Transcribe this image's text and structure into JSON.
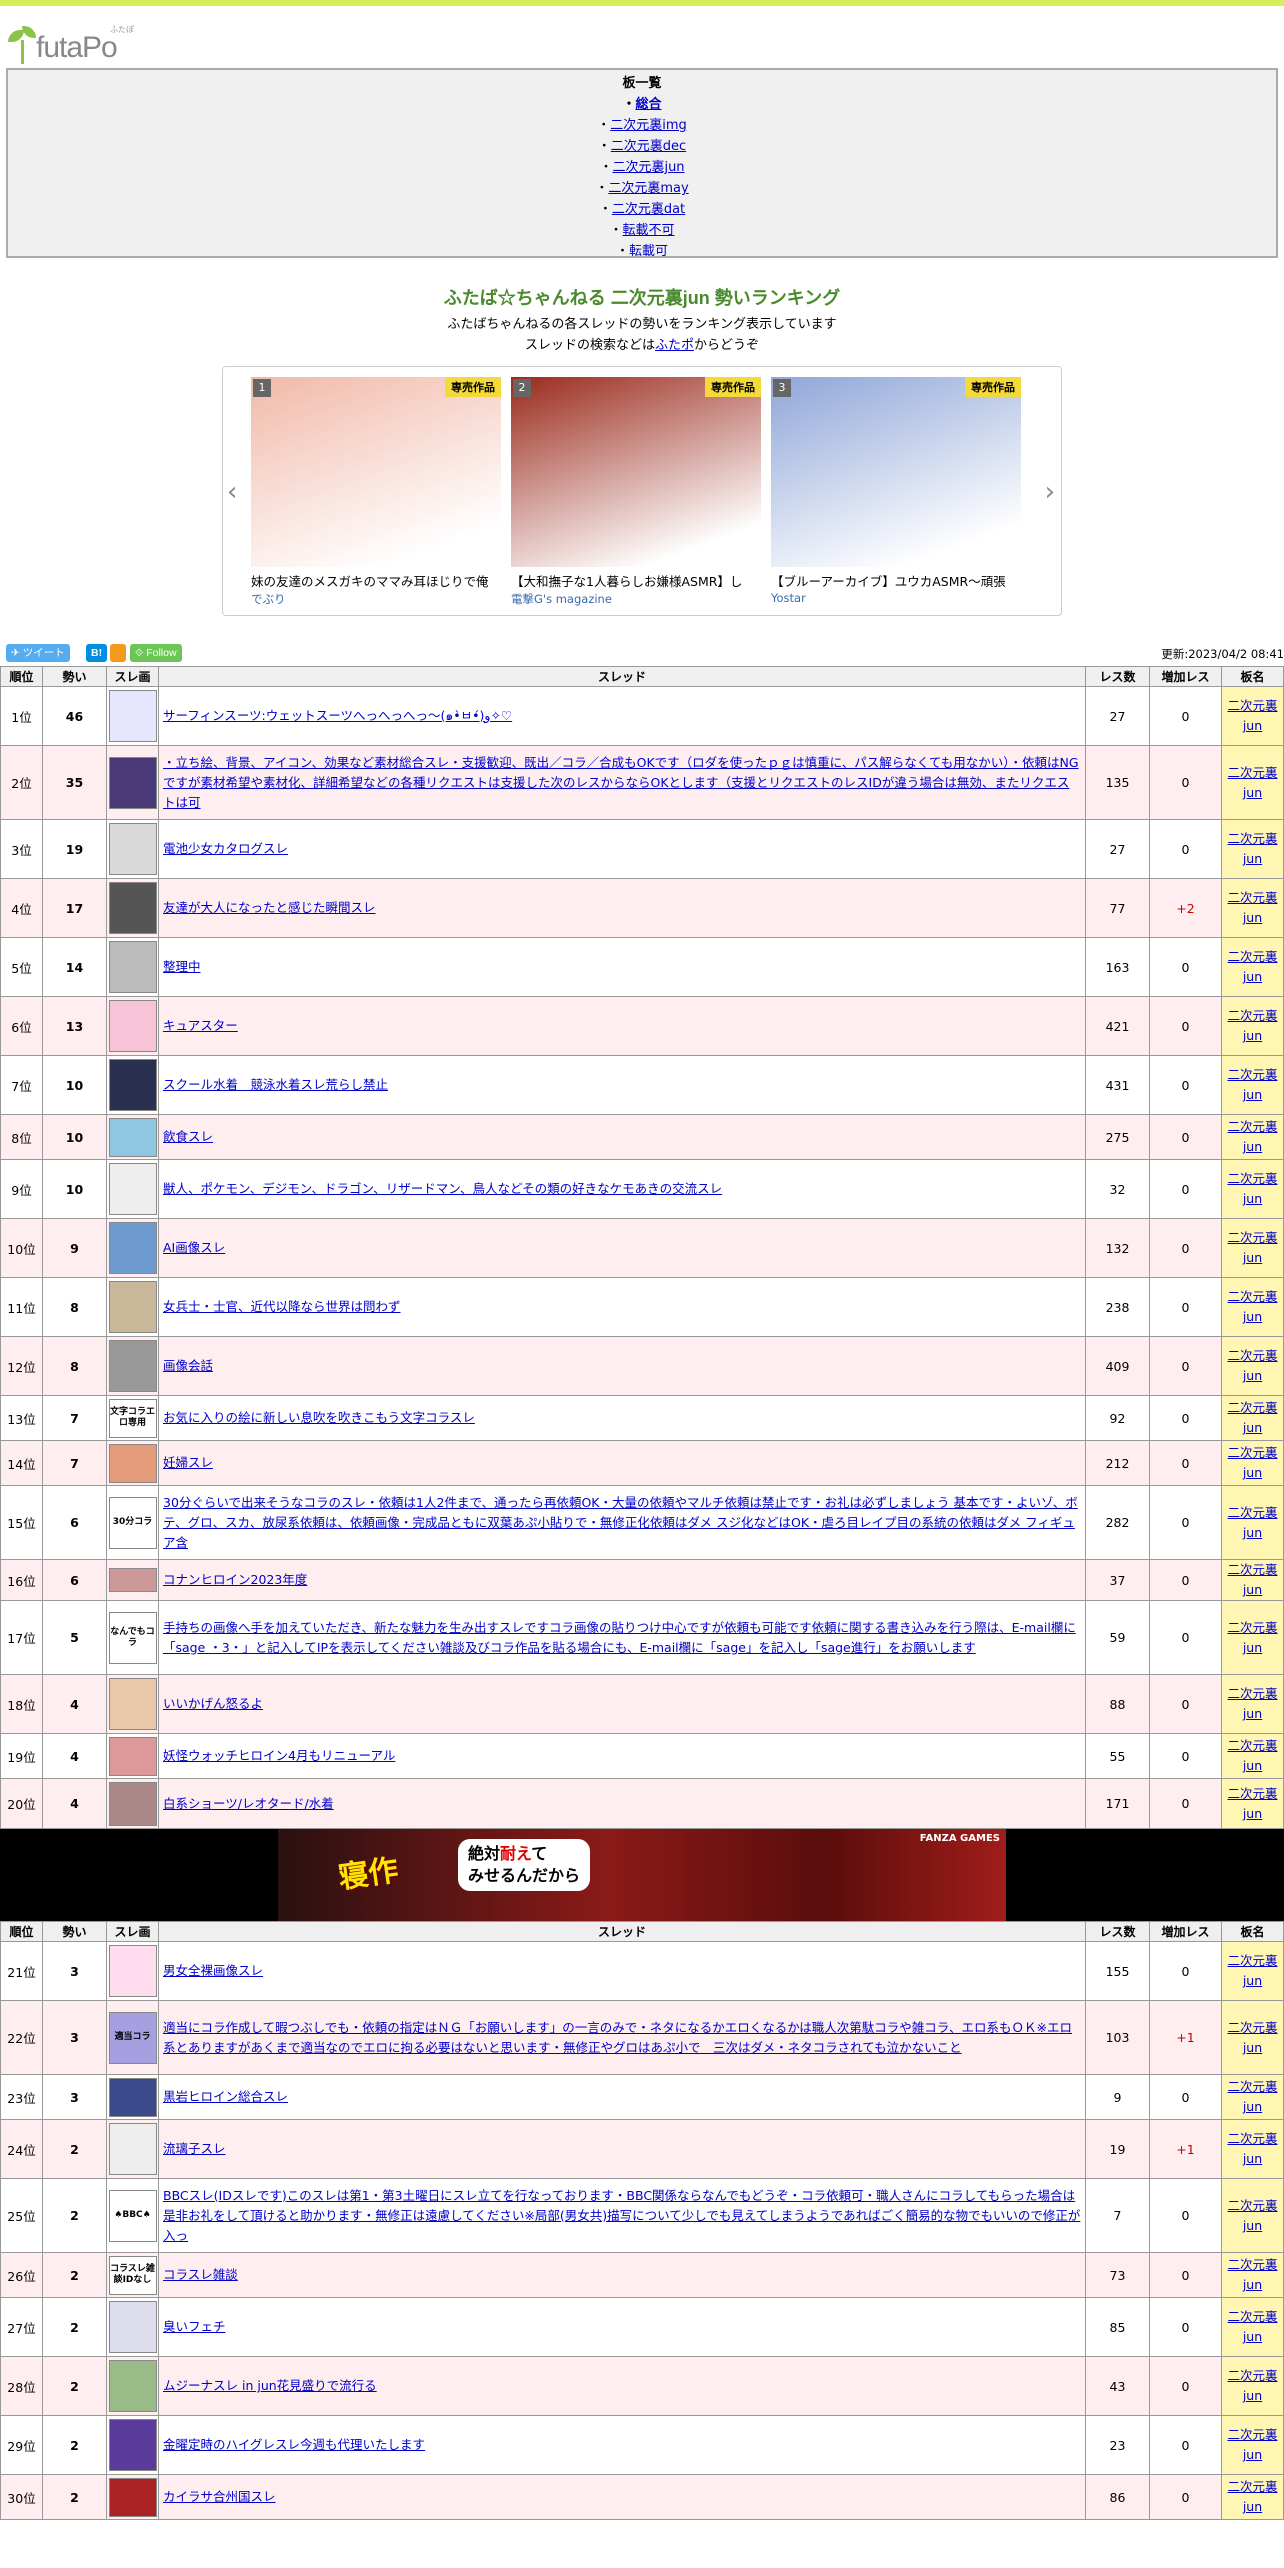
{
  "site": {
    "logo": "futaPo",
    "logo_ruby": "ふたぽ"
  },
  "board_list": {
    "title": "板一覧",
    "items": [
      {
        "label": "総合",
        "selected": true
      },
      {
        "label": "二次元裏img"
      },
      {
        "label": "二次元裏dec"
      },
      {
        "label": "二次元裏jun"
      },
      {
        "label": "二次元裏may"
      },
      {
        "label": "二次元裏dat"
      },
      {
        "label": "転載不可"
      },
      {
        "label": "転載可"
      }
    ]
  },
  "page": {
    "title": "ふたば☆ちゃんねる 二次元裏jun 勢いランキング",
    "desc1": "ふたばちゃんねるの各スレッドの勢いをランキング表示しています",
    "desc2_pre": "スレッドの検索などは",
    "desc2_link": "ふたポ",
    "desc2_post": "からどうぞ"
  },
  "carousel": [
    {
      "rank": "1",
      "tag": "専売作品",
      "title": "妹の友達のメスガキのママみ耳ほじりで俺",
      "circle": "でぶり",
      "color": "#f1b9a8"
    },
    {
      "rank": "2",
      "tag": "専売作品",
      "title": "【大和撫子な1人暮らしお嫌様ASMR】し",
      "circle": "電撃G's magazine",
      "color": "#9a2a1c"
    },
    {
      "rank": "3",
      "tag": "専売作品",
      "title": "【ブルーアーカイブ】ユウカASMR～頑張",
      "circle": "Yostar",
      "color": "#8fa6d8"
    }
  ],
  "social": {
    "tweet": "ツイート",
    "hb": "B!",
    "follow": "Follow",
    "updated": "更新:2023/04/2 08:41"
  },
  "table": {
    "headers": [
      "順位",
      "勢い",
      "スレ画",
      "スレッド",
      "レス数",
      "増加レス",
      "板名"
    ],
    "rows1": [
      {
        "rank": "1位",
        "mom": "46",
        "title": "サーフィンスーツ:ウェットスーツへっへっへっ～(๑•̀ㅂ•́)و✧♡",
        "res": "27",
        "inc": "0",
        "board": "二次元裏jun",
        "thumb": "#e6e6ff"
      },
      {
        "rank": "2位",
        "mom": "35",
        "title": "・立ち絵、背景、アイコン、効果など素材総合スレ・支援歓迎、既出／コラ／合成もOKです（ロダを使ったｐｇは慎重に、パス解らなくても用なかい）・依頼はNGですが素材希望や素材化、詳細希望などの各種リクエストは支援した次のレスからならOKとします（支援とリクエストのレスIDが違う場合は無効、またリクエストは可",
        "res": "135",
        "inc": "0",
        "board": "二次元裏jun",
        "thumb": "#4a3a7a"
      },
      {
        "rank": "3位",
        "mom": "19",
        "title": "電池少女カタログスレ",
        "res": "27",
        "inc": "0",
        "board": "二次元裏jun",
        "thumb": "#d9d9d9"
      },
      {
        "rank": "4位",
        "mom": "17",
        "title": "友達が大人になったと感じた瞬間スレ",
        "res": "77",
        "inc": "+2",
        "board": "二次元裏jun",
        "thumb": "#555"
      },
      {
        "rank": "5位",
        "mom": "14",
        "title": "整理中",
        "res": "163",
        "inc": "0",
        "board": "二次元裏jun",
        "thumb": "#bbb"
      },
      {
        "rank": "6位",
        "mom": "13",
        "title": "キュアスター",
        "res": "421",
        "inc": "0",
        "board": "二次元裏jun",
        "thumb": "#f7c3d6"
      },
      {
        "rank": "7位",
        "mom": "10",
        "title": "スクール水着　競泳水着スレ荒らし禁止",
        "res": "431",
        "inc": "0",
        "board": "二次元裏jun",
        "thumb": "#2a3050"
      },
      {
        "rank": "8位",
        "mom": "10",
        "title": "飲食スレ",
        "res": "275",
        "inc": "0",
        "board": "二次元裏jun",
        "thumb": "#8fc7e0"
      },
      {
        "rank": "9位",
        "mom": "10",
        "title": "獣人、ポケモン、デジモン、ドラゴン、リザードマン、鳥人などその類の好きなケモあきの交流スレ",
        "res": "32",
        "inc": "0",
        "board": "二次元裏jun",
        "thumb": "#eee"
      },
      {
        "rank": "10位",
        "mom": "9",
        "title": "AI画像スレ",
        "res": "132",
        "inc": "0",
        "board": "二次元裏jun",
        "thumb": "#6d9bd0"
      },
      {
        "rank": "11位",
        "mom": "8",
        "title": "女兵士・士官、近代以降なら世界は問わず",
        "res": "238",
        "inc": "0",
        "board": "二次元裏jun",
        "thumb": "#c9b79a"
      },
      {
        "rank": "12位",
        "mom": "8",
        "title": "画像会話",
        "res": "409",
        "inc": "0",
        "board": "二次元裏jun",
        "thumb": "#999"
      },
      {
        "rank": "13位",
        "mom": "7",
        "title": "お気に入りの絵に新しい息吹を吹きこもう文字コラスレ",
        "res": "92",
        "inc": "0",
        "board": "二次元裏jun",
        "thumb": "#fff",
        "text": "文字コラエロ専用"
      },
      {
        "rank": "14位",
        "mom": "7",
        "title": "妊婦スレ",
        "res": "212",
        "inc": "0",
        "board": "二次元裏jun",
        "thumb": "#e59a7a"
      },
      {
        "rank": "15位",
        "mom": "6",
        "title": "30分ぐらいで出来そうなコラのスレ・依頼は1人2件まで、通ったら再依頼OK・大量の依頼やマルチ依頼は禁止です・お礼は必ずしましょう 基本です・よいゾ、ボテ、グロ、スカ、放尿系依頼は、依頼画像・完成品ともに双葉あぷ小貼りで・無修正化依頼はダメ スジ化などはOK・虐ろ目レイプ目の系統の依頼はダメ フィギュア含",
        "res": "282",
        "inc": "0",
        "board": "二次元裏jun",
        "thumb": "#fff",
        "text": "30分コラ"
      },
      {
        "rank": "16位",
        "mom": "6",
        "title": "コナンヒロイン2023年度",
        "res": "37",
        "inc": "0",
        "board": "二次元裏jun",
        "thumb": "#c99"
      },
      {
        "rank": "17位",
        "mom": "5",
        "title": "手持ちの画像へ手を加えていただき、新たな魅力を生み出すスレですコラ画像の貼りつけ中心ですが依頼も可能です依頼に関する書き込みを行う際は、E-mail欄に「sage ・3・」と記入してIPを表示してください雑談及びコラ作品を貼る場合にも、E-mail欄に「sage」を記入し「sage進行」をお願いします",
        "res": "59",
        "inc": "0",
        "board": "二次元裏jun",
        "thumb": "#fff",
        "text": "なんでもコラ"
      },
      {
        "rank": "18位",
        "mom": "4",
        "title": "いいかげん怒るよ",
        "res": "88",
        "inc": "0",
        "board": "二次元裏jun",
        "thumb": "#e8c8a8"
      },
      {
        "rank": "19位",
        "mom": "4",
        "title": "妖怪ウォッチヒロイン4月もリニューアル",
        "res": "55",
        "inc": "0",
        "board": "二次元裏jun",
        "thumb": "#d99"
      },
      {
        "rank": "20位",
        "mom": "4",
        "title": "白系ショーツ/レオタード/水着",
        "res": "171",
        "inc": "0",
        "board": "二次元裏jun",
        "thumb": "#a88"
      }
    ],
    "rows2": [
      {
        "rank": "21位",
        "mom": "3",
        "title": "男女全裸画像スレ",
        "res": "155",
        "inc": "0",
        "board": "二次元裏jun",
        "thumb": "#fde"
      },
      {
        "rank": "22位",
        "mom": "3",
        "title": "適当にコラ作成して暇つぶしでも・依頼の指定はＮＧ「お願いします」の一言のみで・ネタになるかエロくなるかは職人次第駄コラや雑コラ、エロ系もＯＫ※エロ系とありますがあくまで適当なのでエロに拘る必要はないと思います・無修正やグロはあぷ小で　三次はダメ・ネタコラされても泣かないこと",
        "res": "103",
        "inc": "+1",
        "board": "二次元裏jun",
        "thumb": "#a6a0e0",
        "text": "適当コラ"
      },
      {
        "rank": "23位",
        "mom": "3",
        "title": "黒岩ヒロイン総合スレ",
        "res": "9",
        "inc": "0",
        "board": "二次元裏jun",
        "thumb": "#3a4a8a"
      },
      {
        "rank": "24位",
        "mom": "2",
        "title": "流璃子スレ",
        "res": "19",
        "inc": "+1",
        "board": "二次元裏jun",
        "thumb": "#eee"
      },
      {
        "rank": "25位",
        "mom": "2",
        "title": "BBCスレ(IDスレです)このスレは第1・第3土曜日にスレ立てを行なっております・BBC関係ならなんでもどうぞ・コラ依頼可・職人さんにコラしてもらった場合は是非お礼をして頂けると助かります・無修正は遠慮してください※局部(男女共)描写について少しでも見えてしまうようであればごく簡易的な物でもいいので修正が入っ",
        "res": "7",
        "inc": "0",
        "board": "二次元裏jun",
        "thumb": "#fff",
        "text": "♠BBC♠"
      },
      {
        "rank": "26位",
        "mom": "2",
        "title": "コラスレ雑談",
        "res": "73",
        "inc": "0",
        "board": "二次元裏jun",
        "thumb": "#fff",
        "text": "コラスレ雑談IDなし"
      },
      {
        "rank": "27位",
        "mom": "2",
        "title": "臭いフェチ",
        "res": "85",
        "inc": "0",
        "board": "二次元裏jun",
        "thumb": "#dde"
      },
      {
        "rank": "28位",
        "mom": "2",
        "title": "ムジーナスレ in jun花見盛りで流行る",
        "res": "43",
        "inc": "0",
        "board": "二次元裏jun",
        "thumb": "#9b8"
      },
      {
        "rank": "29位",
        "mom": "2",
        "title": "金曜定時のハイグレスレ今週も代理いたします",
        "res": "23",
        "inc": "0",
        "board": "二次元裏jun",
        "thumb": "#5a3a9a"
      },
      {
        "rank": "30位",
        "mom": "2",
        "title": "カイラサ合州国スレ",
        "res": "86",
        "inc": "0",
        "board": "二次元裏jun",
        "thumb": "#a22"
      }
    ]
  },
  "ad": {
    "main": "寝作",
    "bubble1": "絶対",
    "bubble_red": "耐え",
    "bubble2": "て",
    "bubble3": "みせるんだから",
    "logo": "FANZA GAMES"
  }
}
